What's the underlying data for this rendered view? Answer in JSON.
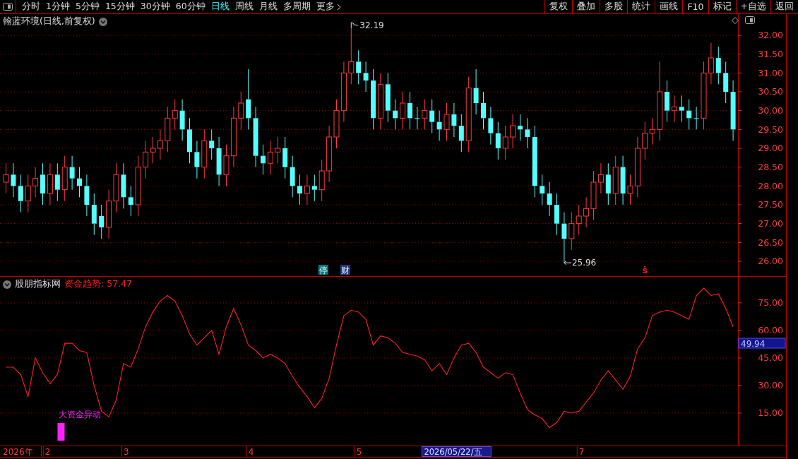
{
  "toolbar": {
    "periods": [
      {
        "label": "分时",
        "selected": false
      },
      {
        "label": "1分钟",
        "selected": false
      },
      {
        "label": "5分钟",
        "selected": false
      },
      {
        "label": "15分钟",
        "selected": false
      },
      {
        "label": "30分钟",
        "selected": false
      },
      {
        "label": "60分钟",
        "selected": false
      },
      {
        "label": "日线",
        "selected": true
      },
      {
        "label": "周线",
        "selected": false
      },
      {
        "label": "月线",
        "selected": false
      },
      {
        "label": "多周期",
        "selected": false
      },
      {
        "label": "更多",
        "selected": false,
        "kind": "more"
      }
    ],
    "actions": [
      "复权",
      "叠加",
      "多股",
      "统计",
      "画线",
      "F10",
      "标记",
      "+自选",
      "返回"
    ]
  },
  "price_panel": {
    "title": "翰蓝环境(日线,前复权)",
    "chart_data": {
      "type": "candlestick",
      "grid": true,
      "ylim": [
        25.606,
        32.5625
      ],
      "yticks": [
        {
          "value": 26,
          "label": "26.00"
        },
        {
          "value": 26.5,
          "label": "26.50"
        },
        {
          "value": 27,
          "label": "27.00"
        },
        {
          "value": 27.5,
          "label": "27.50"
        },
        {
          "value": 28,
          "label": "28.00"
        },
        {
          "value": 28.5,
          "label": "28.50"
        },
        {
          "value": 29,
          "label": "29.00"
        },
        {
          "value": 29.5,
          "label": "29.50"
        },
        {
          "value": 30,
          "label": "30.00"
        },
        {
          "value": 30.5,
          "label": "30.50"
        },
        {
          "value": 31,
          "label": "31.00"
        },
        {
          "value": 31.5,
          "label": "31.50"
        },
        {
          "value": 32,
          "label": "32.00"
        }
      ],
      "ohlc": [
        [
          28.1,
          28.6,
          27.8,
          28.3
        ],
        [
          28.3,
          28.6,
          27.7,
          28.0
        ],
        [
          28.0,
          28.3,
          27.3,
          27.6
        ],
        [
          27.6,
          28.3,
          27.3,
          28.0
        ],
        [
          28.0,
          28.5,
          27.7,
          28.2
        ],
        [
          28.3,
          28.6,
          27.5,
          27.8
        ],
        [
          27.8,
          28.6,
          27.5,
          28.3
        ],
        [
          28.3,
          28.6,
          27.6,
          27.9
        ],
        [
          27.9,
          28.8,
          27.6,
          28.5
        ],
        [
          28.5,
          28.8,
          27.9,
          28.2
        ],
        [
          28.2,
          28.5,
          27.7,
          28.0
        ],
        [
          28.0,
          28.3,
          27.2,
          27.5
        ],
        [
          27.5,
          27.8,
          26.7,
          27.0
        ],
        [
          27.2,
          27.5,
          26.6,
          26.9
        ],
        [
          26.9,
          27.9,
          26.6,
          27.6
        ],
        [
          27.6,
          28.6,
          27.3,
          28.3
        ],
        [
          28.3,
          28.6,
          27.4,
          27.7
        ],
        [
          27.7,
          28.0,
          27.2,
          27.5
        ],
        [
          27.5,
          28.8,
          27.2,
          28.5
        ],
        [
          28.5,
          29.2,
          28.2,
          28.9
        ],
        [
          28.9,
          29.3,
          28.6,
          29.0
        ],
        [
          29.0,
          29.5,
          28.7,
          29.2
        ],
        [
          29.2,
          30.1,
          28.9,
          29.8
        ],
        [
          29.8,
          30.3,
          29.5,
          30.0
        ],
        [
          30.0,
          30.3,
          29.2,
          29.5
        ],
        [
          29.5,
          29.8,
          28.6,
          28.9
        ],
        [
          28.9,
          29.2,
          28.2,
          28.5
        ],
        [
          28.5,
          29.5,
          28.2,
          29.2
        ],
        [
          29.2,
          29.5,
          28.7,
          29.0
        ],
        [
          29.0,
          29.3,
          28.0,
          28.3
        ],
        [
          28.3,
          29.1,
          28.0,
          28.8
        ],
        [
          28.8,
          30.1,
          28.5,
          29.8
        ],
        [
          29.8,
          30.5,
          29.5,
          30.2
        ],
        [
          30.3,
          31.1,
          29.5,
          29.8
        ],
        [
          29.8,
          30.1,
          28.5,
          28.8
        ],
        [
          28.8,
          29.1,
          28.3,
          28.6
        ],
        [
          28.6,
          29.2,
          28.3,
          28.9
        ],
        [
          28.9,
          29.3,
          28.6,
          29.0
        ],
        [
          29.0,
          29.3,
          28.2,
          28.5
        ],
        [
          28.5,
          28.8,
          27.7,
          28.0
        ],
        [
          28.0,
          28.3,
          27.5,
          27.8
        ],
        [
          27.8,
          28.3,
          27.5,
          28.0
        ],
        [
          28.0,
          28.3,
          27.6,
          27.9
        ],
        [
          27.9,
          28.7,
          27.6,
          28.4
        ],
        [
          28.4,
          29.6,
          28.1,
          29.3
        ],
        [
          29.3,
          30.3,
          29.0,
          30.0
        ],
        [
          30.0,
          31.3,
          29.7,
          31.0
        ],
        [
          31.0,
          32.19,
          30.7,
          31.3
        ],
        [
          31.3,
          31.6,
          30.7,
          31.0
        ],
        [
          31.0,
          31.3,
          30.5,
          30.8
        ],
        [
          30.8,
          31.1,
          29.5,
          29.8
        ],
        [
          29.8,
          31.0,
          29.5,
          30.7
        ],
        [
          30.7,
          31.0,
          29.7,
          30.0
        ],
        [
          30.0,
          30.3,
          29.5,
          29.8
        ],
        [
          29.8,
          30.5,
          29.5,
          30.2
        ],
        [
          30.2,
          30.5,
          29.5,
          29.8
        ],
        [
          29.8,
          30.1,
          29.5,
          29.8
        ],
        [
          29.8,
          30.3,
          29.5,
          30.0
        ],
        [
          30.0,
          30.3,
          29.4,
          29.7
        ],
        [
          29.7,
          30.0,
          29.2,
          29.5
        ],
        [
          29.5,
          30.2,
          29.2,
          29.9
        ],
        [
          29.9,
          30.2,
          29.3,
          29.6
        ],
        [
          29.6,
          29.9,
          28.9,
          29.2
        ],
        [
          29.2,
          30.9,
          28.9,
          30.6
        ],
        [
          30.6,
          31.1,
          29.9,
          30.2
        ],
        [
          30.2,
          30.5,
          29.5,
          29.8
        ],
        [
          29.8,
          30.1,
          29.1,
          29.4
        ],
        [
          29.4,
          29.7,
          28.7,
          29.0
        ],
        [
          29.0,
          29.6,
          28.7,
          29.3
        ],
        [
          29.3,
          29.9,
          29.0,
          29.6
        ],
        [
          29.6,
          29.9,
          29.2,
          29.5
        ],
        [
          29.5,
          29.8,
          29.0,
          29.3
        ],
        [
          29.3,
          29.6,
          27.7,
          28.0
        ],
        [
          28.0,
          28.3,
          27.5,
          27.8
        ],
        [
          27.8,
          28.1,
          27.2,
          27.5
        ],
        [
          27.5,
          27.8,
          26.7,
          27.0
        ],
        [
          27.0,
          27.3,
          25.96,
          26.6
        ],
        [
          26.6,
          27.3,
          26.3,
          27.0
        ],
        [
          27.0,
          27.5,
          26.7,
          27.2
        ],
        [
          27.2,
          27.7,
          26.9,
          27.4
        ],
        [
          27.4,
          28.4,
          27.1,
          28.1
        ],
        [
          28.1,
          28.6,
          27.8,
          28.3
        ],
        [
          28.3,
          28.6,
          27.5,
          27.8
        ],
        [
          27.8,
          28.8,
          27.5,
          28.5
        ],
        [
          28.5,
          28.8,
          27.5,
          27.8
        ],
        [
          27.8,
          28.3,
          27.5,
          28.0
        ],
        [
          28.0,
          29.3,
          27.7,
          29.0
        ],
        [
          29.0,
          29.7,
          28.7,
          29.4
        ],
        [
          29.4,
          29.8,
          29.1,
          29.5
        ],
        [
          29.5,
          31.3,
          29.2,
          30.5
        ],
        [
          30.5,
          30.8,
          29.7,
          30.0
        ],
        [
          30.0,
          30.4,
          29.7,
          30.1
        ],
        [
          30.1,
          30.4,
          29.7,
          30.0
        ],
        [
          30.0,
          30.3,
          29.5,
          29.8
        ],
        [
          29.8,
          30.1,
          29.5,
          29.8
        ],
        [
          29.8,
          31.3,
          29.5,
          31.0
        ],
        [
          31.0,
          31.8,
          30.7,
          31.4
        ],
        [
          31.4,
          31.7,
          30.7,
          31.0
        ],
        [
          31.0,
          31.3,
          30.2,
          30.5
        ],
        [
          30.5,
          30.8,
          29.2,
          29.5
        ]
      ],
      "annotations": [
        "32.19",
        "25.96"
      ]
    },
    "markers": [
      {
        "text": "停",
        "kind": "halt"
      },
      {
        "text": "财",
        "kind": "finance"
      },
      {
        "text": "ŝ",
        "kind": "sell"
      }
    ]
  },
  "indicator_panel": {
    "source": "股朋指标网",
    "indicator": "资金趋势: 57.47",
    "current_value": "49.94",
    "chart_data": {
      "type": "line",
      "grid": true,
      "ylim": [
        -2.7,
        89.2
      ],
      "yticks": [
        {
          "value": 15,
          "label": "15.00"
        },
        {
          "value": 30,
          "label": "30.00"
        },
        {
          "value": 45,
          "label": "45.00"
        },
        {
          "value": 60,
          "label": "60.00"
        },
        {
          "value": 75,
          "label": "75.00"
        }
      ],
      "series": [
        {
          "color": "#ff2020",
          "values": [
            40,
            40,
            36,
            24,
            45,
            37,
            31,
            36,
            53,
            53,
            49,
            48,
            30,
            16,
            13,
            22,
            42,
            40,
            50,
            62,
            70,
            76,
            79,
            76,
            68,
            58,
            52,
            56,
            60,
            47,
            62,
            72,
            63,
            52,
            49,
            45,
            47,
            45,
            42,
            35,
            29,
            24,
            18,
            23,
            34,
            52,
            68,
            71,
            70,
            66,
            52,
            57,
            56,
            53,
            48,
            47,
            46,
            44,
            38,
            42,
            36,
            45,
            52,
            53,
            48,
            40,
            37,
            34,
            37,
            36,
            26,
            17,
            14,
            12,
            7,
            10,
            16,
            15,
            16,
            21,
            26,
            33,
            38,
            33,
            28,
            35,
            50,
            56,
            68,
            70,
            71,
            70,
            68,
            66,
            79,
            83,
            79,
            80,
            72,
            62
          ]
        }
      ],
      "annotations": [
        "大资金异动"
      ]
    }
  },
  "date_axis": {
    "year": "2026年",
    "months": [
      "2",
      "3",
      "4",
      "5",
      "7"
    ],
    "cursor_date": "2026/05/22/五"
  }
}
